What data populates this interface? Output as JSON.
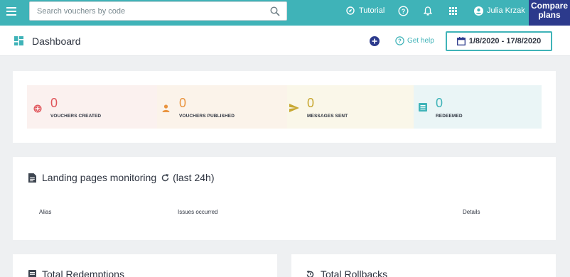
{
  "topbar": {
    "search_placeholder": "Search vouchers by code",
    "tutorial_label": "Tutorial",
    "user_name": "Julia Krzak",
    "compare_label": "Compare plans"
  },
  "header": {
    "title": "Dashboard",
    "help_label": "Get help",
    "date_range": "1/8/2020 - 17/8/2020"
  },
  "stats": [
    {
      "value": "0",
      "label": "VOUCHERS CREATED",
      "color": "#e0565b",
      "bg": "#fbf1ef"
    },
    {
      "value": "0",
      "label": "VOUCHERS PUBLISHED",
      "color": "#e9943f",
      "bg": "#fbf3ea"
    },
    {
      "value": "0",
      "label": "MESSAGES SENT",
      "color": "#c8a832",
      "bg": "#faf7e9"
    },
    {
      "value": "0",
      "label": "REDEEMED",
      "color": "#3fb3b8",
      "bg": "#eaf5f6"
    }
  ],
  "landing": {
    "title": "Landing pages monitoring",
    "suffix": "(last 24h)",
    "columns": [
      "Alias",
      "Issues occurred",
      "Details"
    ]
  },
  "bottom": {
    "redemptions_title": "Total Redemptions",
    "rollbacks_title": "Total Rollbacks"
  },
  "colors": {
    "teal": "#3fb3b8",
    "navy": "#2c3a8c"
  }
}
